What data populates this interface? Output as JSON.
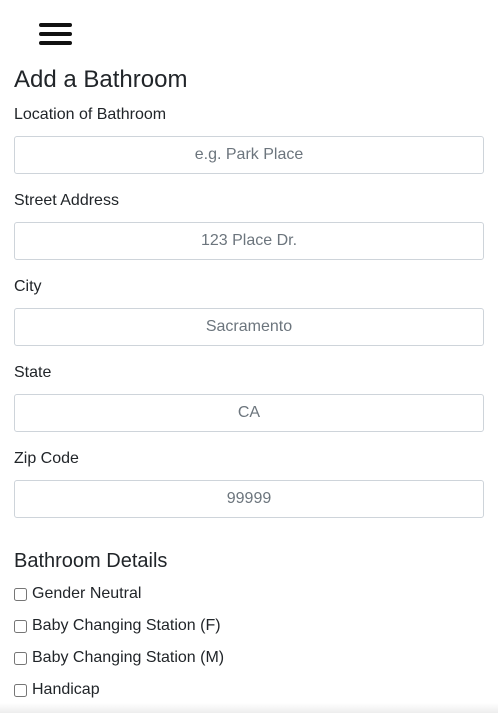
{
  "header": {
    "menu_icon": "hamburger-menu-icon"
  },
  "form": {
    "title": "Add a Bathroom",
    "fields": [
      {
        "label": "Location of Bathroom",
        "placeholder": "e.g. Park Place",
        "value": ""
      },
      {
        "label": "Street Address",
        "placeholder": "123 Place Dr.",
        "value": ""
      },
      {
        "label": "City",
        "placeholder": "Sacramento",
        "value": ""
      },
      {
        "label": "State",
        "placeholder": "CA",
        "value": ""
      },
      {
        "label": "Zip Code",
        "placeholder": "99999",
        "value": ""
      }
    ]
  },
  "details": {
    "title": "Bathroom Details",
    "options": [
      {
        "label": "Gender Neutral",
        "checked": false
      },
      {
        "label": "Baby Changing Station (F)",
        "checked": false
      },
      {
        "label": "Baby Changing Station (M)",
        "checked": false
      },
      {
        "label": "Handicap",
        "checked": false
      }
    ]
  }
}
